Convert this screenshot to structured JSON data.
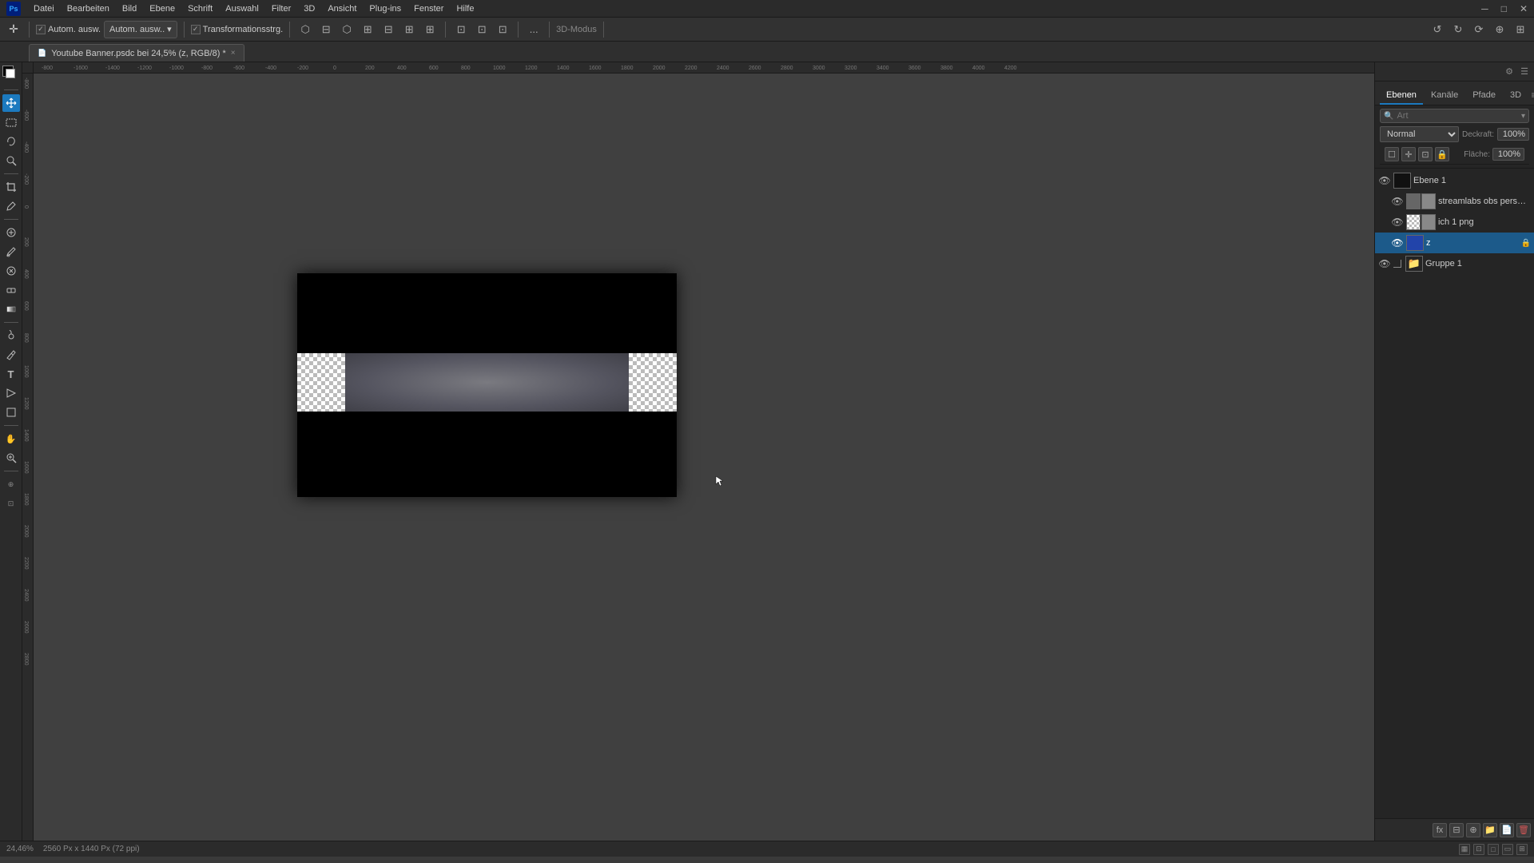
{
  "titlebar": {
    "app_name": "Adobe Photoshop",
    "window_controls": [
      "minimize",
      "maximize",
      "close"
    ]
  },
  "menubar": {
    "items": [
      "Datei",
      "Bearbeiten",
      "Bild",
      "Ebene",
      "Schrift",
      "Auswahl",
      "Filter",
      "3D",
      "Ansicht",
      "Plug-ins",
      "Fenster",
      "Hilfe"
    ]
  },
  "options_bar": {
    "auto_select_label": "Autom. ausw.",
    "transform_label": "Transformationsstrg.",
    "more_btn": "...",
    "mode_label": "3D-Modus"
  },
  "document_tab": {
    "filename": "Youtube Banner.psdc bei 24,5% (z, RGB/8) *",
    "close_btn": "×"
  },
  "canvas": {
    "zoom": "24,46%",
    "doc_size": "2560 Px x 1440 Px (72 ppi)"
  },
  "ruler": {
    "top_marks": [
      "-800",
      "-1600",
      "-1400",
      "-1200",
      "-1000",
      "-800",
      "-600",
      "-400",
      "-200",
      "0",
      "200",
      "400",
      "600",
      "800",
      "1000",
      "1200",
      "1400",
      "1600",
      "1800",
      "2000",
      "2200",
      "2400",
      "2600",
      "2800",
      "2800",
      "3000",
      "3200",
      "3400",
      "3600",
      "3800",
      "4000",
      "4200"
    ]
  },
  "right_panel": {
    "tabs": [
      "Ebenen",
      "Kanäle",
      "Pfade",
      "3D"
    ],
    "active_tab": "Ebenen",
    "search_placeholder": "Art",
    "blend_mode": "Normal",
    "opacity_label": "Deckraft:",
    "opacity_value": "100%",
    "flaeche_label": "Fläche:",
    "flaeche_value": "100%"
  },
  "layers": [
    {
      "id": "layer1",
      "name": "Ebene 1",
      "visible": true,
      "selected": false,
      "type": "fill",
      "indent": 0
    },
    {
      "id": "layer2",
      "name": "streamlabs obs personal use",
      "visible": true,
      "selected": false,
      "type": "image",
      "indent": 1
    },
    {
      "id": "layer3",
      "name": "ich 1 png",
      "visible": true,
      "selected": false,
      "type": "image_mask",
      "indent": 1
    },
    {
      "id": "layer4",
      "name": "z",
      "visible": true,
      "selected": true,
      "type": "image",
      "indent": 1
    },
    {
      "id": "layer5",
      "name": "Gruppe 1",
      "visible": true,
      "selected": false,
      "type": "folder",
      "indent": 0
    }
  ],
  "layer_actions": {
    "buttons": [
      "fx",
      "mask",
      "adjustment",
      "group",
      "new",
      "delete"
    ]
  },
  "status_bar": {
    "zoom": "24,46%",
    "doc_info": "2560 Px x 1440 Px (72 ppi)"
  },
  "tools": {
    "items": [
      {
        "id": "move",
        "icon": "✛",
        "active": true
      },
      {
        "id": "select-rect",
        "icon": "⬚"
      },
      {
        "id": "lasso",
        "icon": "⌾"
      },
      {
        "id": "quick-select",
        "icon": "✦"
      },
      {
        "id": "crop",
        "icon": "⊡"
      },
      {
        "id": "eyedropper",
        "icon": "🔬"
      },
      {
        "id": "healing",
        "icon": "✚"
      },
      {
        "id": "brush",
        "icon": "✏"
      },
      {
        "id": "clone-stamp",
        "icon": "⊕"
      },
      {
        "id": "eraser",
        "icon": "▭"
      },
      {
        "id": "gradient",
        "icon": "▦"
      },
      {
        "id": "dodge",
        "icon": "◑"
      },
      {
        "id": "pen",
        "icon": "✒"
      },
      {
        "id": "type",
        "icon": "T"
      },
      {
        "id": "path-select",
        "icon": "↖"
      },
      {
        "id": "shape",
        "icon": "□"
      },
      {
        "id": "hand",
        "icon": "✋"
      },
      {
        "id": "zoom",
        "icon": "⊕"
      }
    ]
  }
}
